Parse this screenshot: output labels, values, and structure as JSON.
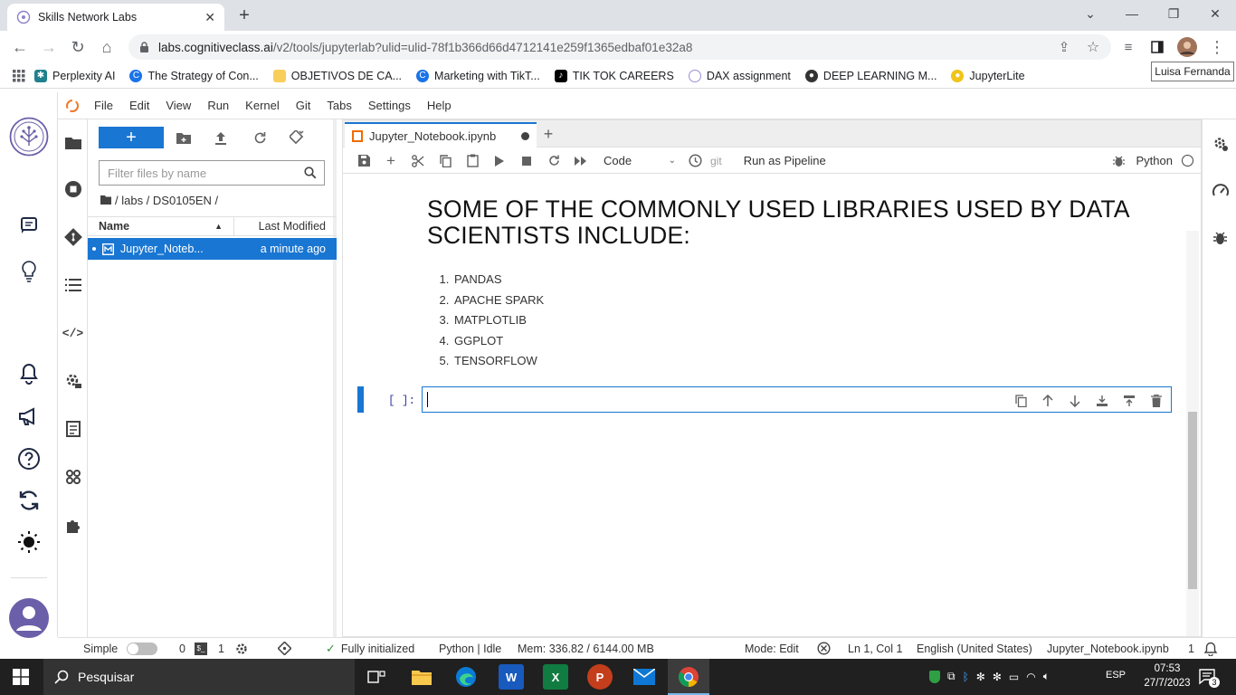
{
  "browser": {
    "tab_title": "Skills Network Labs",
    "url_host": "labs.cognitiveclass.ai",
    "url_path": "/v2/tools/jupyterlab?ulid=ulid-78f1b366d66d4712141e259f1365edbaf01e32a8",
    "profile_tooltip": "Luisa Fernanda",
    "bookmarks": [
      {
        "label": "Perplexity AI",
        "icon": "perplexity-icon",
        "color": "#20808d"
      },
      {
        "label": "The Strategy of Con...",
        "icon": "cognitiveclass-icon",
        "color": "#1a73e8"
      },
      {
        "label": "OBJETIVOS DE CA...",
        "icon": "folder-icon",
        "color": "#f9ce5a"
      },
      {
        "label": "Marketing with TikT...",
        "icon": "cognitiveclass-icon",
        "color": "#1a73e8"
      },
      {
        "label": "TIK TOK CAREERS",
        "icon": "tiktok-icon",
        "color": "#000000"
      },
      {
        "label": "DAX assignment",
        "icon": "skills-icon",
        "color": "#9c8fd6"
      },
      {
        "label": "DEEP LEARNING M...",
        "icon": "globe-icon",
        "color": "#333333"
      },
      {
        "label": "JupyterLite",
        "icon": "jupyterlite-icon",
        "color": "#f0c419"
      }
    ]
  },
  "menu": [
    "File",
    "Edit",
    "View",
    "Run",
    "Kernel",
    "Git",
    "Tabs",
    "Settings",
    "Help"
  ],
  "filebrowser": {
    "filter_placeholder": "Filter files by name",
    "breadcrumb": "/ labs / DS0105EN /",
    "col_name": "Name",
    "col_modified": "Last Modified",
    "files": [
      {
        "name": "Jupyter_Noteb...",
        "modified": "a minute ago"
      }
    ]
  },
  "notebook": {
    "tab_title": "Jupyter_Notebook.ipynb",
    "cell_type": "Code",
    "git_label": "git",
    "run_pipeline": "Run as Pipeline",
    "kernel": "Python",
    "heading": "SOME OF THE COMMONLY USED LIBRARIES USED BY DATA SCIENTISTS INCLUDE:",
    "libraries": [
      "PANDAS",
      "APACHE SPARK",
      "MATPLOTLIB",
      "GGPLOT",
      "TENSORFLOW"
    ],
    "prompt": "[ ]:"
  },
  "status": {
    "mode_simple": "Simple",
    "terminals": "0",
    "kernels": "1",
    "initialized": "Fully initialized",
    "kernel_state": "Python | Idle",
    "memory": "Mem: 336.82 / 6144.00 MB",
    "mode": "Mode: Edit",
    "cursor": "Ln 1, Col 1",
    "language": "English (United States)",
    "filename": "Jupyter_Notebook.ipynb",
    "count": "1"
  },
  "taskbar": {
    "search_label": "Pesquisar",
    "lang": "ESP",
    "time": "07:53",
    "date": "27/7/2023",
    "notifications": "3"
  },
  "colors": {
    "accent": "#1976d2",
    "taskbar": "#202020"
  }
}
